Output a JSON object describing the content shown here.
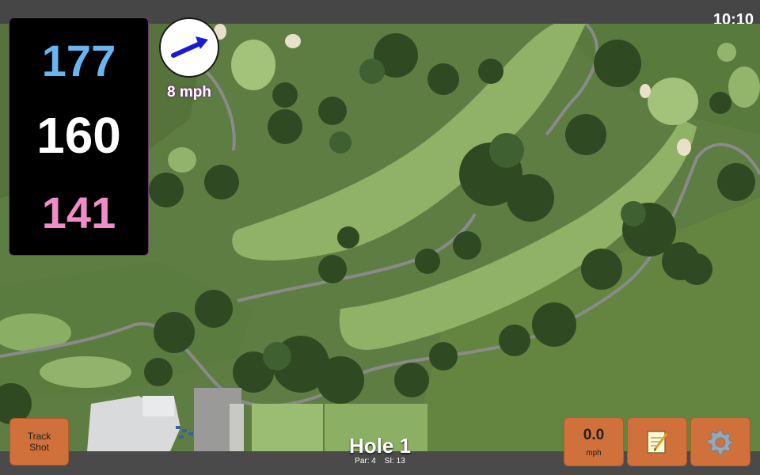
{
  "status": {
    "time": "10:10"
  },
  "yardages": {
    "back": "177",
    "middle": "160",
    "front": "141"
  },
  "wind": {
    "speed": "8 mph"
  },
  "buttons": {
    "track_shot": [
      "Track",
      "Shot"
    ],
    "speed_value": "0.0",
    "speed_unit": "mph",
    "notes_icon": "notepad-icon",
    "settings_icon": "gear-icon"
  },
  "hole": {
    "title": "Hole 1",
    "par": "Par: 4",
    "si": "SI: 13"
  },
  "colors": {
    "back": "#6ab4f0",
    "middle": "#ffffff",
    "front": "#f08cc8",
    "button": "#d0703a",
    "wind_arrow": "#1a1ad0"
  }
}
